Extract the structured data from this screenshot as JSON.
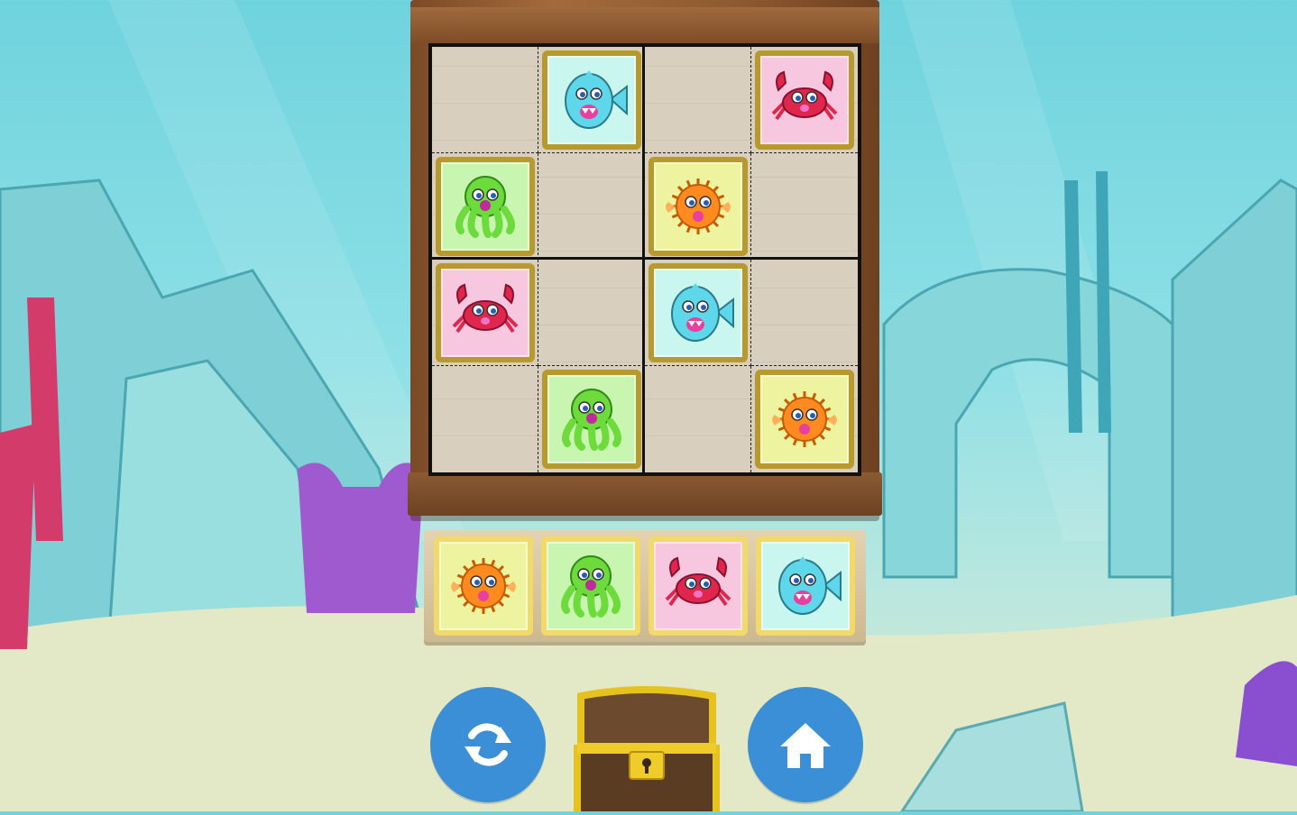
{
  "colors": {
    "water": "#6fd3de",
    "sand": "#dfe8c8",
    "wood": "#8d5a31",
    "button": "#3a8fd6",
    "tile_border_board": "#b79a2b",
    "tile_border_tray": "#f2da6a"
  },
  "creatures": {
    "fish": {
      "icon": "shark-fish-icon",
      "bg": "#c9f7f0",
      "body": "#5ed7ea"
    },
    "crab": {
      "icon": "crab-icon",
      "bg": "#f7c7df",
      "body": "#e0264c"
    },
    "octopus": {
      "icon": "octopus-icon",
      "bg": "#c8f5b0",
      "body": "#6ddb3c"
    },
    "pufferfish": {
      "icon": "pufferfish-icon",
      "bg": "#eef3a0",
      "body": "#ff8a1f"
    }
  },
  "board": {
    "size": 4,
    "cells": [
      [
        null,
        "fish",
        null,
        "crab"
      ],
      [
        "octopus",
        null,
        "pufferfish",
        null
      ],
      [
        "crab",
        null,
        "fish",
        null
      ],
      [
        null,
        "octopus",
        null,
        "pufferfish"
      ]
    ]
  },
  "tray": [
    "pufferfish",
    "octopus",
    "crab",
    "fish"
  ],
  "controls": {
    "refresh": {
      "icon": "refresh-icon"
    },
    "home": {
      "icon": "home-icon"
    },
    "chest": {
      "icon": "treasure-chest-icon"
    }
  }
}
